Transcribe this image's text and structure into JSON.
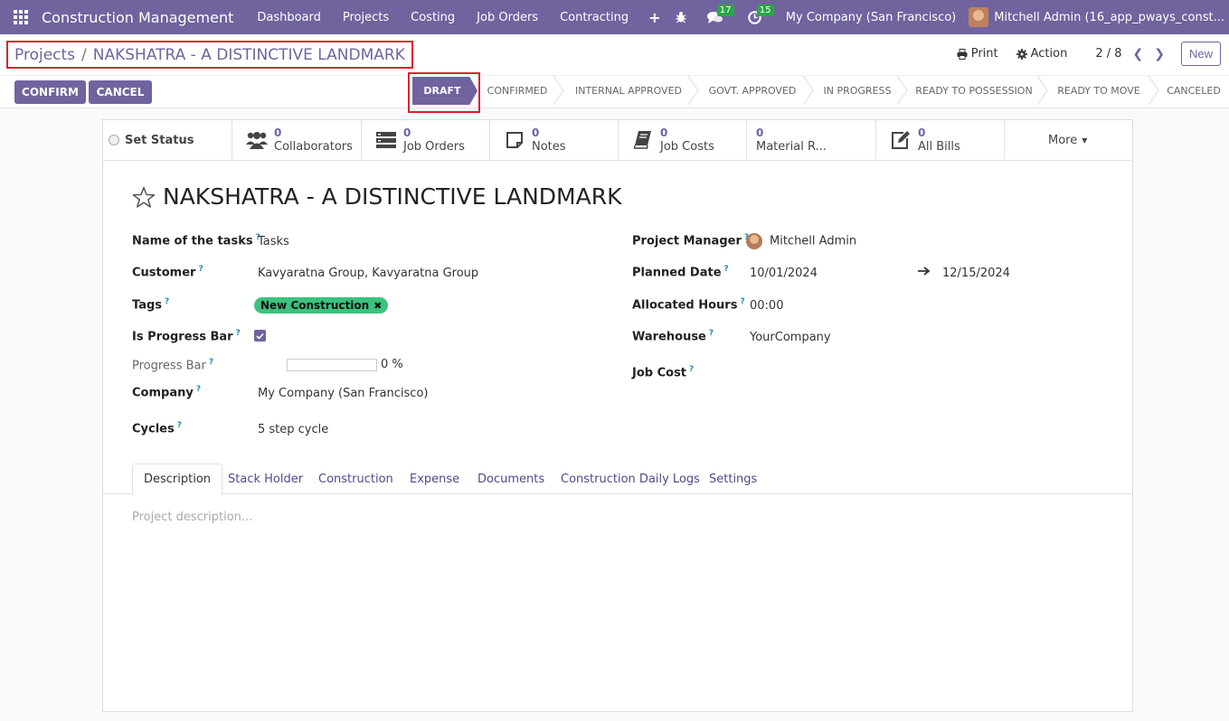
{
  "navbar": {
    "brand": "Construction Management",
    "menu": [
      "Dashboard",
      "Projects",
      "Costing",
      "Job Orders",
      "Contracting"
    ],
    "plus": "+",
    "messages_count": "17",
    "activities_count": "15",
    "company": "My Company (San Francisco)",
    "user": "Mitchell Admin (16_app_pways_const..."
  },
  "control": {
    "breadcrumb_parent": "Projects",
    "breadcrumb_sep": "/",
    "breadcrumb_current": "NAKSHATRA - A DISTINCTIVE LANDMARK",
    "print_label": "Print",
    "action_label": "Action",
    "pager": "2 / 8",
    "new_label": "New"
  },
  "actions": {
    "confirm": "CONFIRM",
    "cancel": "CANCEL"
  },
  "statusbar": {
    "current": "DRAFT",
    "stages": [
      "CONFIRMED",
      "INTERNAL APPROVED",
      "GOVT. APPROVED",
      "IN PROGRESS",
      "READY TO POSSESSION",
      "READY TO MOVE",
      "CANCELED"
    ]
  },
  "smart_buttons": {
    "set_status": "Set Status",
    "collaborators": {
      "count": "0",
      "label": "Collaborators"
    },
    "job_orders": {
      "count": "0",
      "label": "Job Orders"
    },
    "notes": {
      "count": "0",
      "label": "Notes"
    },
    "job_costs": {
      "count": "0",
      "label": "Job Costs"
    },
    "material": {
      "count": "0",
      "label": "Material R..."
    },
    "all_bills": {
      "count": "0",
      "label": "All Bills"
    },
    "more": "More"
  },
  "record": {
    "title": "NAKSHATRA - A DISTINCTIVE LANDMARK",
    "tip": "?",
    "left": {
      "name_of_tasks_label": "Name of the tasks",
      "name_of_tasks": "Tasks",
      "customer_label": "Customer",
      "customer": "Kavyaratna Group, Kavyaratna Group",
      "tags_label": "Tags",
      "tag": "New Construction",
      "is_progress_label": "Is Progress Bar",
      "is_progress": true,
      "progress_label": "Progress Bar",
      "progress": "0 %",
      "company_label": "Company",
      "company": "My Company (San Francisco)",
      "cycles_label": "Cycles",
      "cycles": "5 step cycle"
    },
    "right": {
      "manager_label": "Project Manager",
      "manager": "Mitchell Admin",
      "planned_label": "Planned Date",
      "planned_start": "10/01/2024",
      "planned_end": "12/15/2024",
      "hours_label": "Allocated Hours",
      "hours": "00:00",
      "warehouse_label": "Warehouse",
      "warehouse": "YourCompany",
      "jobcost_label": "Job Cost"
    }
  },
  "tabs": [
    "Description",
    "Stack Holder",
    "Construction",
    "Expense",
    "Documents",
    "Construction Daily Logs",
    "Settings"
  ],
  "description_placeholder": "Project description...",
  "colors": {
    "brand": "#71639e",
    "highlight": "#d9232e",
    "tag": "#3cc27e",
    "badge": "#28a745"
  }
}
